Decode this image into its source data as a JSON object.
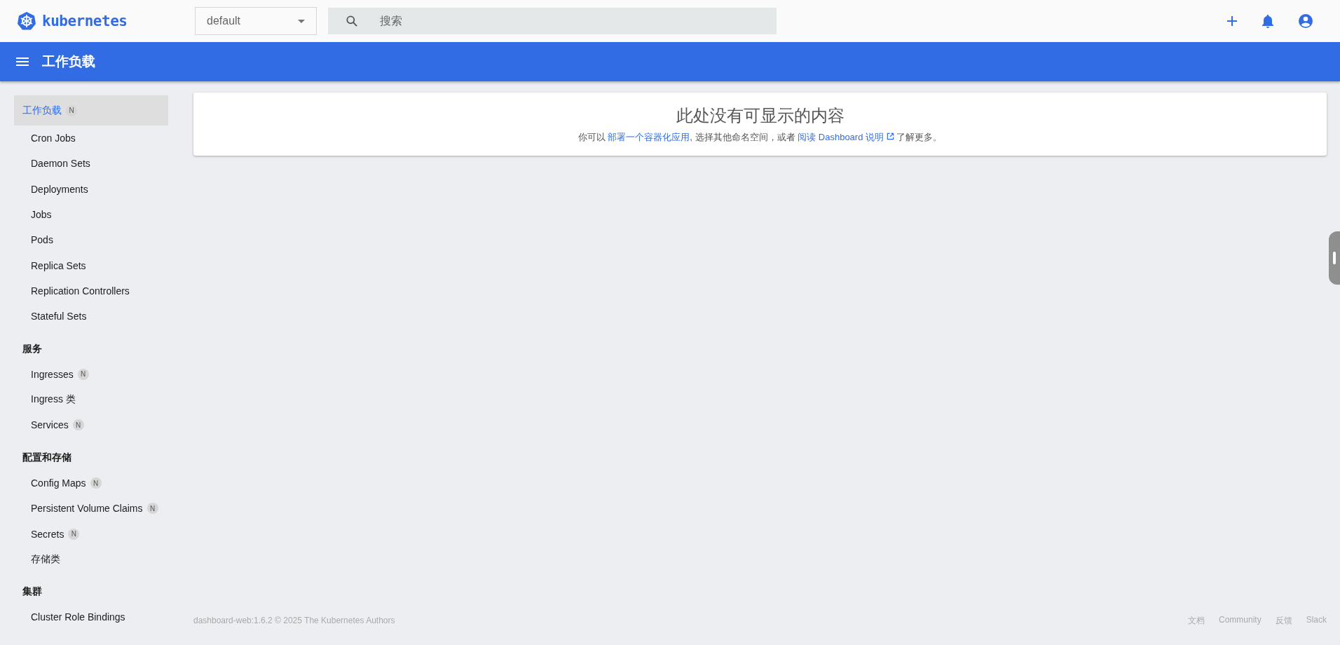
{
  "header": {
    "logo_text": "kubernetes",
    "namespace": "default",
    "search": {
      "placeholder": "搜索"
    }
  },
  "toolbar": {
    "title": "工作负载"
  },
  "sidebar": {
    "sections": [
      {
        "title": "工作负载",
        "badge": "N",
        "selected": true,
        "items": [
          {
            "label": "Cron Jobs",
            "selected": false
          },
          {
            "label": "Daemon Sets",
            "selected": false
          },
          {
            "label": "Deployments",
            "selected": false
          },
          {
            "label": "Jobs",
            "selected": false
          },
          {
            "label": "Pods",
            "selected": false
          },
          {
            "label": "Replica Sets",
            "selected": false
          },
          {
            "label": "Replication Controllers",
            "selected": false
          },
          {
            "label": "Stateful Sets",
            "selected": false
          }
        ]
      },
      {
        "title": "服务",
        "selected": false,
        "items": [
          {
            "label": "Ingresses",
            "badge": "N",
            "selected": false
          },
          {
            "label": "Ingress 类",
            "selected": false
          },
          {
            "label": "Services",
            "badge": "N",
            "selected": false
          }
        ]
      },
      {
        "title": "配置和存储",
        "selected": false,
        "items": [
          {
            "label": "Config Maps",
            "badge": "N",
            "selected": false
          },
          {
            "label": "Persistent Volume Claims",
            "badge": "N",
            "selected": false
          },
          {
            "label": "Secrets",
            "badge": "N",
            "selected": false
          },
          {
            "label": "存储类",
            "selected": false
          }
        ]
      },
      {
        "title": "集群",
        "selected": false,
        "items": [
          {
            "label": "Cluster Role Bindings",
            "selected": false
          }
        ]
      }
    ]
  },
  "empty_state": {
    "title": "此处没有可显示的内容",
    "parts": [
      {
        "kind": "text",
        "text": "你可以 "
      },
      {
        "kind": "link",
        "text": "部署一个容器化应用"
      },
      {
        "kind": "text",
        "text": ", 选择其他命名空间，或者 "
      },
      {
        "kind": "external",
        "text": "阅读 Dashboard 说明"
      },
      {
        "kind": "text",
        "text": " 了解更多。"
      }
    ]
  },
  "footer": {
    "version": "dashboard-web:1.6.2 © 2025 The Kubernetes Authors",
    "links": [
      "文档",
      "Community",
      "反馈",
      "Slack"
    ]
  }
}
